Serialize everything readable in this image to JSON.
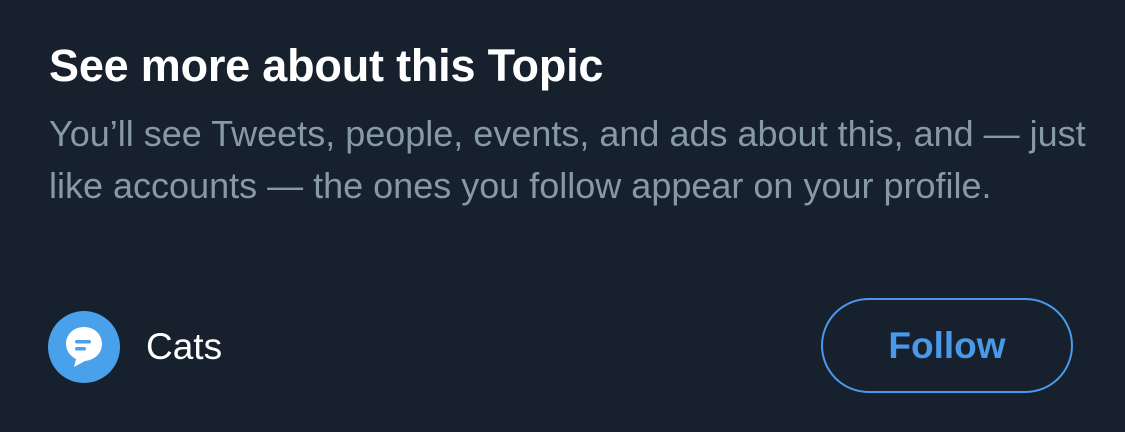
{
  "card": {
    "title": "See more about this Topic",
    "description": "You’ll see Tweets, people, events, and ads about this, and — just like accounts — the ones you follow appear on your profile."
  },
  "topic": {
    "name": "Cats",
    "icon": "topic-speech-bubble-icon"
  },
  "actions": {
    "follow_label": "Follow"
  },
  "colors": {
    "background": "#17202d",
    "accent": "#4a99e9",
    "icon_bg": "#4aa1eb",
    "secondary_text": "#8899a6",
    "primary_text": "#ffffff"
  }
}
